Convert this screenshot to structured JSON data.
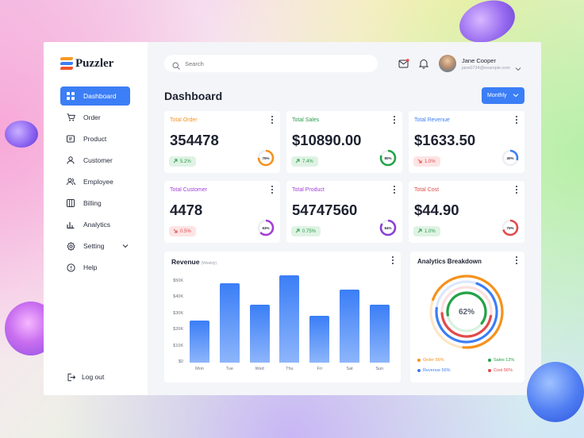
{
  "app": {
    "name": "Puzzler"
  },
  "sidebar": {
    "items": [
      {
        "label": "Dashboard",
        "icon": "dashboard-icon",
        "active": true
      },
      {
        "label": "Order",
        "icon": "cart-icon"
      },
      {
        "label": "Product",
        "icon": "box-icon"
      },
      {
        "label": "Customer",
        "icon": "user-icon"
      },
      {
        "label": "Employee",
        "icon": "users-icon"
      },
      {
        "label": "Billing",
        "icon": "billing-icon"
      },
      {
        "label": "Analytics",
        "icon": "analytics-icon"
      },
      {
        "label": "Setting",
        "icon": "gear-icon"
      },
      {
        "label": "Help",
        "icon": "help-icon"
      }
    ],
    "logout": "Log out"
  },
  "header": {
    "search_placeholder": "Search",
    "user_name": "Jane Cooper",
    "user_email": "jane0734@example.com"
  },
  "page": {
    "title": "Dashboard",
    "period": "Monthly"
  },
  "stats": [
    {
      "label": "Total Order",
      "value": "354478",
      "change": "5.2%",
      "trend": "up",
      "progress_label": "75%",
      "progress": 0.75,
      "label_color": "#f5921e",
      "ring_color": "#f5921e"
    },
    {
      "label": "Total Sales",
      "value": "$10890.00",
      "change": "7.4%",
      "trend": "up",
      "progress_label": "80%",
      "progress": 0.8,
      "label_color": "#2a9a4a",
      "ring_color": "#22a347"
    },
    {
      "label": "Total Revenue",
      "value": "$1633.50",
      "change": "1.0%",
      "trend": "down",
      "progress_label": "30%",
      "progress": 0.3,
      "label_color": "#3b7ef6",
      "ring_color": "#3b7ef6"
    },
    {
      "label": "Total Customer",
      "value": "4478",
      "change": "0.5%",
      "trend": "down",
      "progress_label": "63%",
      "progress": 0.63,
      "label_color": "#a23fd6",
      "ring_color": "#a23fd6"
    },
    {
      "label": "Total Product",
      "value": "54747560",
      "change": "0.75%",
      "trend": "up",
      "progress_label": "84%",
      "progress": 0.84,
      "label_color": "#a23fd6",
      "ring_color": "#8a3fd6"
    },
    {
      "label": "Total Cost",
      "value": "$44.90",
      "change": "1.0%",
      "trend": "up",
      "progress_label": "70%",
      "progress": 0.7,
      "label_color": "#e24b4b",
      "ring_color": "#e24b4b"
    }
  ],
  "revenue": {
    "title": "Revenue",
    "subtitle": "(Weekly)"
  },
  "analytics": {
    "title": "Analytics Breakdown",
    "center_label": "62%",
    "legend": [
      {
        "label": "Order 56%",
        "color": "#f5921e"
      },
      {
        "label": "Sales 12%",
        "color": "#22a347"
      },
      {
        "label": "Revenue 56%",
        "color": "#3b7ef6"
      },
      {
        "label": "Cost 56%",
        "color": "#e24b4b"
      }
    ]
  },
  "chart_data": {
    "type": "bar",
    "title": "Revenue",
    "subtitle": "(Weekly)",
    "categories": [
      "Mon",
      "Tue",
      "Wed",
      "Thu",
      "Fri",
      "Sat",
      "Sun"
    ],
    "values": [
      26,
      49,
      36,
      54,
      29,
      45,
      36
    ],
    "y_ticks": [
      "$0",
      "$10K",
      "$20K",
      "$30K",
      "$40K",
      "$50K"
    ],
    "ylim": [
      0,
      50
    ],
    "xlabel": "",
    "ylabel": "",
    "color": "#3b7ef6"
  }
}
